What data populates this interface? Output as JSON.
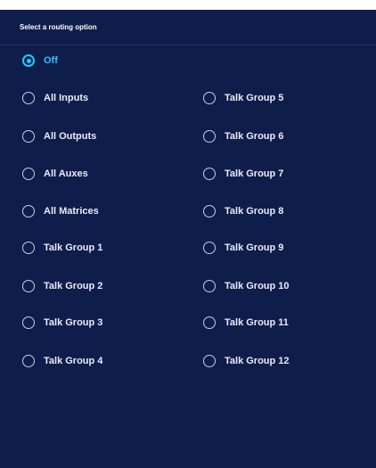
{
  "header": {
    "title": "Select a routing option"
  },
  "options": [
    {
      "label": "Off",
      "selected": true
    },
    {
      "label": "All Inputs",
      "selected": false
    },
    {
      "label": "All Outputs",
      "selected": false
    },
    {
      "label": "All Auxes",
      "selected": false
    },
    {
      "label": "All Matrices",
      "selected": false
    },
    {
      "label": "Talk Group 1",
      "selected": false
    },
    {
      "label": "Talk Group 2",
      "selected": false
    },
    {
      "label": "Talk Group 3",
      "selected": false
    },
    {
      "label": "Talk Group 4",
      "selected": false
    },
    {
      "label": "Talk Group 5",
      "selected": false
    },
    {
      "label": "Talk Group 6",
      "selected": false
    },
    {
      "label": "Talk Group 7",
      "selected": false
    },
    {
      "label": "Talk Group 8",
      "selected": false
    },
    {
      "label": "Talk Group 9",
      "selected": false
    },
    {
      "label": "Talk Group 10",
      "selected": false
    },
    {
      "label": "Talk Group 11",
      "selected": false
    },
    {
      "label": "Talk Group 12",
      "selected": false
    }
  ],
  "colors": {
    "panel_background": "#0f1d4b",
    "accent": "#23c6ff",
    "text": "#e8ecf7"
  }
}
